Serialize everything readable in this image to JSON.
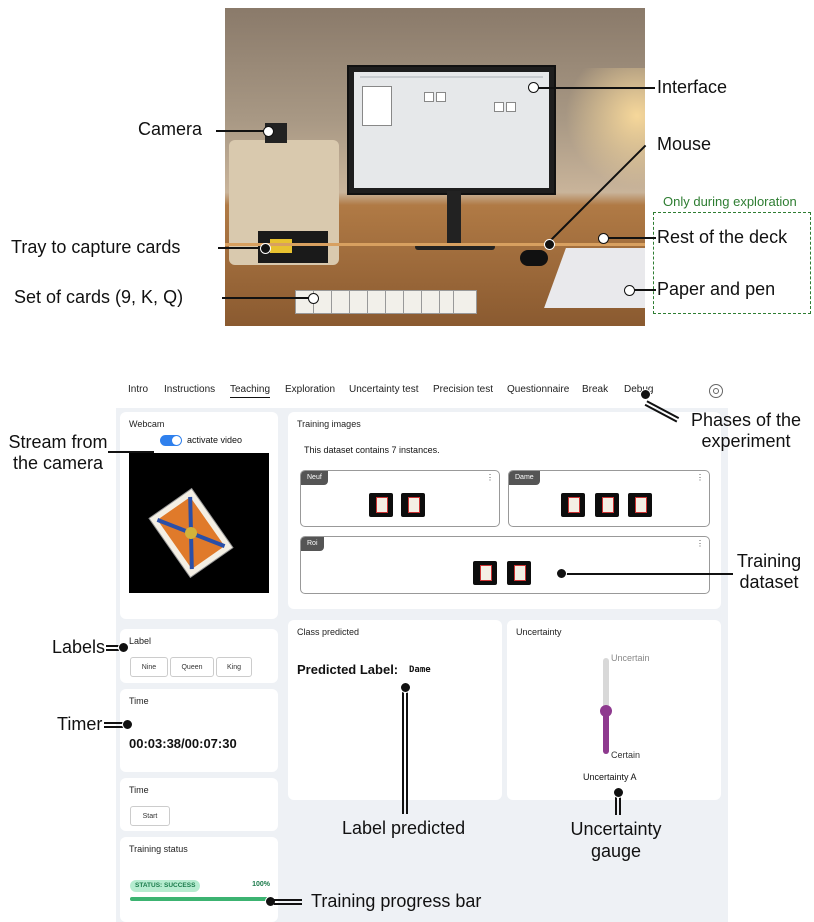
{
  "photo_labels": {
    "interface": "Interface",
    "camera": "Camera",
    "mouse": "Mouse",
    "tray": "Tray to capture cards",
    "only_exploration": "Only during exploration",
    "rest_of_deck": "Rest of the deck",
    "cards_set": "Set of cards (9, K, Q)",
    "paper_pen": "Paper and pen"
  },
  "ui_annotations": {
    "phases": "Phases of the experiment",
    "stream": "Stream from the camera",
    "labels": "Labels",
    "timer": "Timer",
    "training_dataset": "Training dataset",
    "label_predicted": "Label predicted",
    "uncertainty_gauge": "Uncertainty gauge",
    "training_progress": "Training progress bar"
  },
  "nav": {
    "tabs": [
      "Intro",
      "Instructions",
      "Teaching",
      "Exploration",
      "Uncertainty test",
      "Precision test",
      "Questionnaire",
      "Break",
      "Debug"
    ],
    "active": "Teaching"
  },
  "webcam": {
    "title": "Webcam",
    "toggle_label": "activate video",
    "toggle_on": true
  },
  "label_panel": {
    "title": "Label",
    "buttons": [
      "Nine",
      "Queen",
      "King"
    ]
  },
  "time_panel": {
    "title": "Time",
    "value": "00:03:38/00:07:30"
  },
  "time_control": {
    "title": "Time",
    "button": "Start"
  },
  "training_status": {
    "title": "Training status",
    "badge": "STATUS: SUCCESS",
    "percent_label": "100%",
    "progress": 1.0,
    "color": "#3cb371"
  },
  "training_images": {
    "title": "Training images",
    "summary": "This dataset contains 7 instances.",
    "classes": [
      {
        "name": "Neuf",
        "count": 2
      },
      {
        "name": "Dame",
        "count": 3
      },
      {
        "name": "Roi",
        "count": 2
      }
    ]
  },
  "class_predicted": {
    "title": "Class predicted",
    "label_prefix": "Predicted Label:",
    "value": "Dame"
  },
  "uncertainty": {
    "title": "Uncertainty",
    "top_label": "Uncertain",
    "bottom_label": "Certain",
    "caption": "Uncertainty A",
    "level": 0.45,
    "color": "#8e3a8f"
  }
}
